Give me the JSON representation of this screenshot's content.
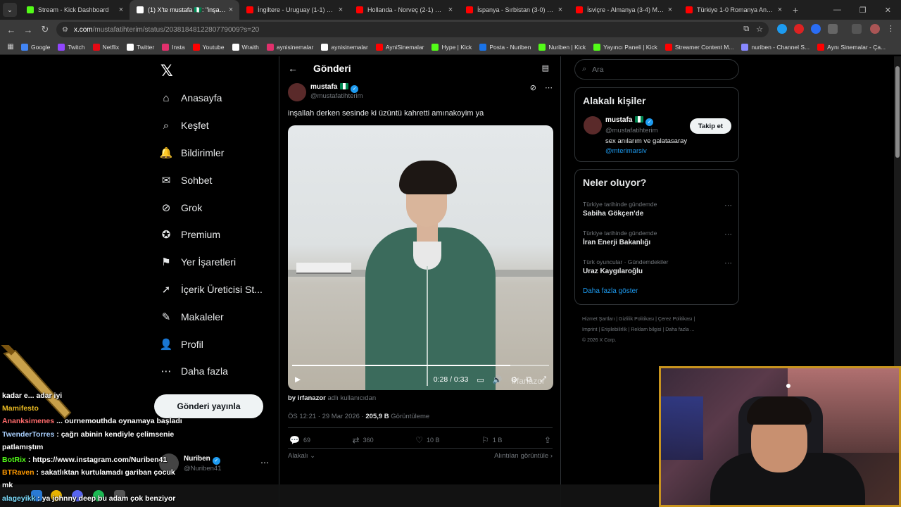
{
  "browser": {
    "tabs": [
      {
        "title": "Stream - Kick Dashboard",
        "color": "#53fc18",
        "active": false
      },
      {
        "title": "(1) X'te mustafa 🇳🇬: \"inşallah de",
        "color": "#ffffff",
        "active": true
      },
      {
        "title": "İngiltere - Uruguay (1-1) Maç Ö",
        "color": "#ff0000",
        "active": false
      },
      {
        "title": "Hollanda - Norveç (2-1) Maç Ö",
        "color": "#ff0000",
        "active": false
      },
      {
        "title": "İspanya - Sırbistan (3-0) Maç Ö",
        "color": "#ff0000",
        "active": false
      },
      {
        "title": "İsviçre - Almanya (3-4) Maç Öz",
        "color": "#ff0000",
        "active": false
      },
      {
        "title": "Türkiye 1-0 Romanya Analizi -",
        "color": "#ff0000",
        "active": false
      }
    ],
    "url_host": "x.com",
    "url_path": "/mustafatihterim/status/2038184812280779009?s=20",
    "bookmarks": [
      {
        "label": "Google",
        "color": "#4285f4"
      },
      {
        "label": "Twitch",
        "color": "#9146ff"
      },
      {
        "label": "Netflix",
        "color": "#e50914"
      },
      {
        "label": "Twitter",
        "color": "#ffffff"
      },
      {
        "label": "Insta",
        "color": "#e1306c"
      },
      {
        "label": "Youtube",
        "color": "#ff0000"
      },
      {
        "label": "Wraith",
        "color": "#ffffff"
      },
      {
        "label": "aynisinemalar",
        "color": "#e1306c"
      },
      {
        "label": "aynisinemalar",
        "color": "#ffffff"
      },
      {
        "label": "AyniSinemalar",
        "color": "#ff0000"
      },
      {
        "label": "Hype | Kick",
        "color": "#53fc18"
      },
      {
        "label": "Posta - Nuriben",
        "color": "#1a73e8"
      },
      {
        "label": "Nuriben | Kick",
        "color": "#53fc18"
      },
      {
        "label": "Yayıncı Paneli | Kick",
        "color": "#53fc18"
      },
      {
        "label": "Streamer Content M...",
        "color": "#ff0000"
      },
      {
        "label": "nuriben - Channel S...",
        "color": "#8888ff"
      },
      {
        "label": "Aynı Sinemalar - Ça...",
        "color": "#ff0000"
      }
    ]
  },
  "sidebar": {
    "items": [
      {
        "label": "Anasayfa",
        "icon": "home-icon",
        "glyph": "⌂"
      },
      {
        "label": "Keşfet",
        "icon": "search-icon",
        "glyph": "⌕"
      },
      {
        "label": "Bildirimler",
        "icon": "bell-icon",
        "glyph": "🔔"
      },
      {
        "label": "Sohbet",
        "icon": "mail-icon",
        "glyph": "✉"
      },
      {
        "label": "Grok",
        "icon": "grok-icon",
        "glyph": "⊘"
      },
      {
        "label": "Premium",
        "icon": "premium-icon",
        "glyph": "✪"
      },
      {
        "label": "Yer İşaretleri",
        "icon": "bookmark-icon",
        "glyph": "⚑"
      },
      {
        "label": "İçerik Üreticisi St...",
        "icon": "rocket-icon",
        "glyph": "➚"
      },
      {
        "label": "Makaleler",
        "icon": "article-icon",
        "glyph": "✎"
      },
      {
        "label": "Profil",
        "icon": "profile-icon",
        "glyph": "👤"
      },
      {
        "label": "Daha fazla",
        "icon": "more-icon",
        "glyph": "⋯"
      }
    ],
    "post_button": "Gönderi yayınla",
    "account_name": "Nuriben",
    "account_handle": "@Nuriben41"
  },
  "post": {
    "header_title": "Gönderi",
    "author_name": "mustafa",
    "author_handle": "@mustafatihterim",
    "text": "inşallah derken sesinde ki üzüntü kahretti amınakoyim ya",
    "video_time": "0:28 / 0:33",
    "video_progress": 0.85,
    "watermark": "irfanazor",
    "by_user": "by irfanazor",
    "by_suffix": "adlı kullanıcıdan",
    "timestamp": "ÖS 12:21 · 29 Mar 2026 ·",
    "views": "205,9 B",
    "views_label": "Görüntüleme",
    "replies": "69",
    "reposts": "360",
    "likes": "10 B",
    "bookmarks": "1 B",
    "relevant_label": "Alakalı",
    "quotes_label": "Alıntıları görüntüle"
  },
  "right": {
    "search_placeholder": "Ara",
    "related_title": "Alakalı kişiler",
    "rel_name": "mustafa",
    "rel_handle": "@mustafatihterim",
    "rel_bio": "sex anılarım ve galatasaray",
    "rel_bio_link": "@mterimarsiv",
    "follow_label": "Takip et",
    "trends_title": "Neler oluyor?",
    "trends": [
      {
        "context": "Türkiye tarihinde gündemde",
        "name": "Sabiha Gökçen'de"
      },
      {
        "context": "Türkiye tarihinde gündemde",
        "name": "İran Enerji Bakanlığı"
      },
      {
        "context": "Türk oyuncular · Gündemdekiler",
        "name": "Uraz Kaygılaroğlu"
      }
    ],
    "show_more": "Daha fazla göster",
    "legal_line1": "Hizmet Şartları  |  Gizlilik Politikası  |  Çerez Politikası  |",
    "legal_line2": "Imprint  |  Erişilebilirlik  |  Reklam bilgisi  |  Daha fazla ...",
    "legal_line3": "© 2026 X Corp."
  },
  "chat": {
    "lines": [
      {
        "user": "",
        "text": "kadar e... adar iyi",
        "color": "#ffffff"
      },
      {
        "user": "Mamifesto",
        "text": "",
        "color": "#e8b923"
      },
      {
        "user": "Ananksimenes",
        "text": "... ournemouthda oynamaya başladı",
        "color": "#ff6b6b"
      },
      {
        "user": "TwenderTorres",
        "text": ": çağrı abinin kendiyle çelimsenie",
        "color": "#a9d0ff"
      },
      {
        "user": "",
        "text": "patlamıştım",
        "color": "#ffffff"
      },
      {
        "user": "BotRix",
        "text": ": https://www.instagram.com/Nuriben41",
        "color": "#53fc18"
      },
      {
        "user": "BTRaven",
        "text": ": sakatlıktan kurtulamadı gariban çocuk",
        "color": "#ff9900"
      },
      {
        "user": "",
        "text": "mk",
        "color": "#ffffff"
      },
      {
        "user": "alageyikk",
        "text": ": ya johnny deep bu adam çok benziyor",
        "color": "#7fdfff"
      }
    ]
  }
}
